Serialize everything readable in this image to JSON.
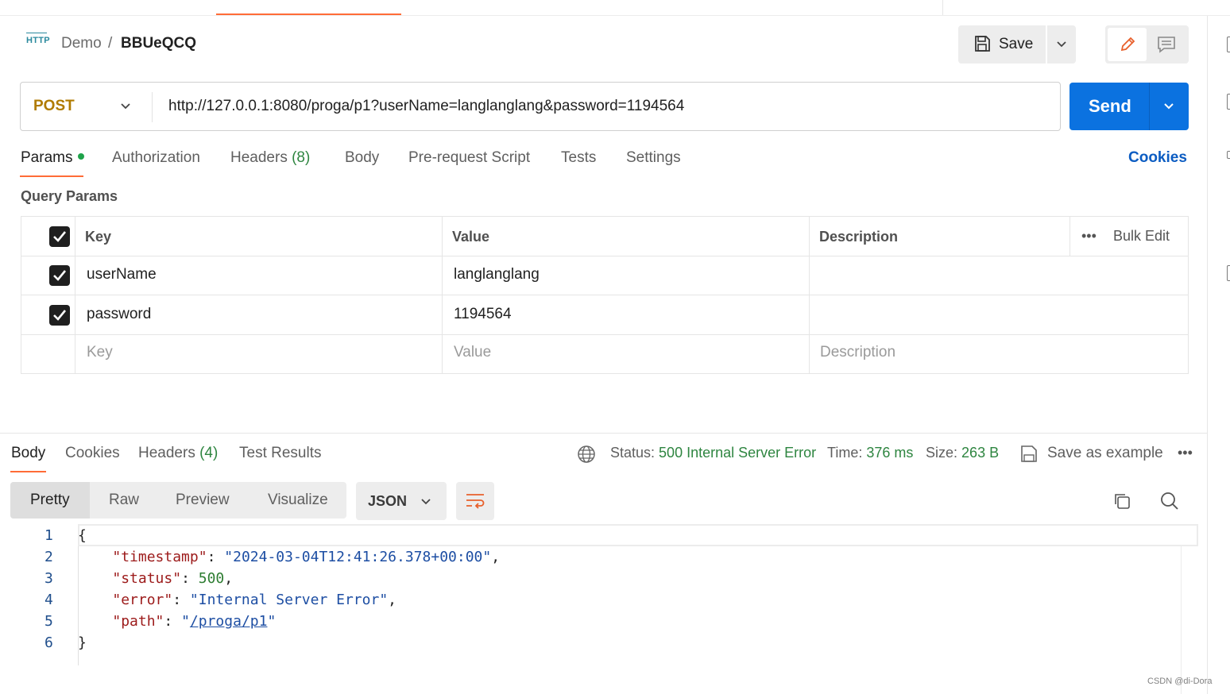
{
  "breadcrumb": {
    "icon_text": "HTTP",
    "collection": "Demo",
    "separator": "/",
    "request": "BBUeQCQ"
  },
  "toolbar": {
    "save_label": "Save"
  },
  "request": {
    "method": "POST",
    "url": "http://127.0.0.1:8080/proga/p1?userName=langlanglang&password=1194564",
    "send_label": "Send"
  },
  "request_tabs": [
    {
      "label": "Params",
      "count": ""
    },
    {
      "label": "Authorization",
      "count": ""
    },
    {
      "label": "Headers",
      "count": "(8)"
    },
    {
      "label": "Body",
      "count": ""
    },
    {
      "label": "Pre-request Script",
      "count": ""
    },
    {
      "label": "Tests",
      "count": ""
    },
    {
      "label": "Settings",
      "count": ""
    }
  ],
  "cookies_link": "Cookies",
  "query_params": {
    "title": "Query Params",
    "headers": {
      "key": "Key",
      "value": "Value",
      "description": "Description",
      "bulk_edit": "Bulk Edit",
      "more": "•••"
    },
    "rows": [
      {
        "key": "userName",
        "value": "langlanglang",
        "description": "",
        "checked": true
      },
      {
        "key": "password",
        "value": "1194564",
        "description": "",
        "checked": true
      }
    ],
    "placeholders": {
      "key": "Key",
      "value": "Value",
      "description": "Description"
    }
  },
  "response": {
    "tabs": [
      {
        "label": "Body",
        "count": ""
      },
      {
        "label": "Cookies",
        "count": ""
      },
      {
        "label": "Headers",
        "count": "(4)"
      },
      {
        "label": "Test Results",
        "count": ""
      }
    ],
    "status_label": "Status:",
    "status_value": "500 Internal Server Error",
    "time_label": "Time:",
    "time_value": "376 ms",
    "size_label": "Size:",
    "size_value": "263 B",
    "save_example": "Save as example",
    "more": "•••",
    "view_tabs": [
      "Pretty",
      "Raw",
      "Preview",
      "Visualize"
    ],
    "format": "JSON",
    "line_numbers": [
      "1",
      "2",
      "3",
      "4",
      "5",
      "6"
    ],
    "body": {
      "open": "{",
      "close": "}",
      "timestamp_key": "\"timestamp\"",
      "timestamp_val": "\"2024-03-04T12:41:26.378+00:00\"",
      "status_key": "\"status\"",
      "status_val": "500",
      "error_key": "\"error\"",
      "error_val": "\"Internal Server Error\"",
      "path_key": "\"path\"",
      "path_val": "/proga/p1"
    }
  },
  "watermark": "CSDN @di-Dora",
  "colors": {
    "accent": "#ff6c37",
    "send": "#0b72e0",
    "method": "#b07b00",
    "success": "#2e8540"
  }
}
